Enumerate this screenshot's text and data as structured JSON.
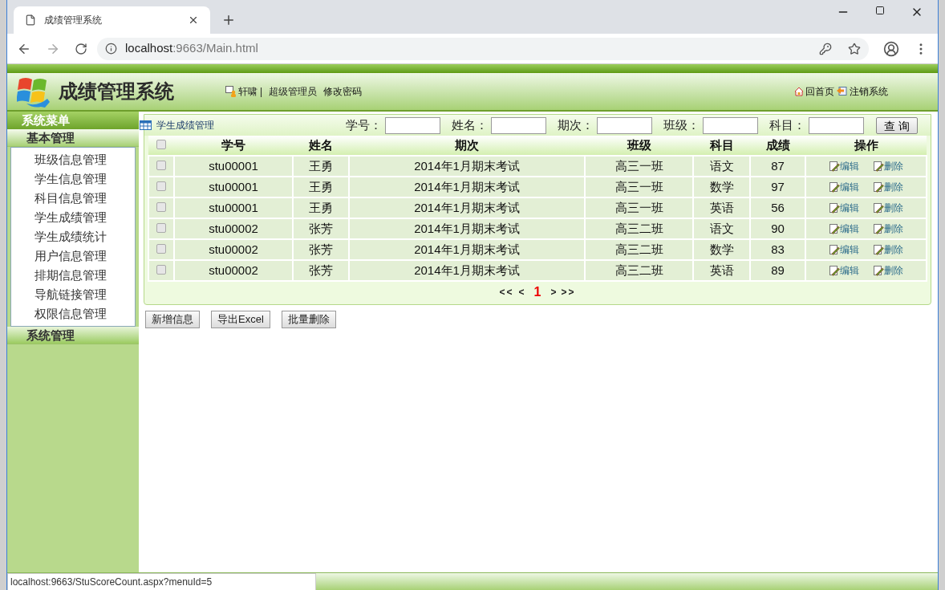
{
  "browser": {
    "tab_title": "成绩管理系统",
    "url_host": "localhost",
    "url_path": ":9663/Main.html"
  },
  "header": {
    "title": "成绩管理系统",
    "user": "轩啸",
    "separator": "|",
    "role": "超级管理员",
    "change_password": "修改密码",
    "home": "回首页",
    "logout": "注销系统"
  },
  "sidebar": {
    "title": "系统菜单",
    "groups": [
      {
        "label": "基本管理",
        "expanded": true,
        "items": [
          "班级信息管理",
          "学生信息管理",
          "科目信息管理",
          "学生成绩管理",
          "学生成绩统计",
          "用户信息管理",
          "排期信息管理",
          "导航链接管理",
          "权限信息管理"
        ]
      },
      {
        "label": "系统管理",
        "expanded": false
      }
    ]
  },
  "panel": {
    "title": "学生成绩管理",
    "filters": [
      "学号：",
      "姓名：",
      "期次：",
      "班级：",
      "科目："
    ],
    "search_button": "查 询"
  },
  "table": {
    "header_checked": false,
    "columns": [
      "学号",
      "姓名",
      "期次",
      "班级",
      "科目",
      "成绩",
      "操作"
    ],
    "rows": [
      {
        "checked": false,
        "cells": [
          "stu00001",
          "王勇",
          "2014年1月期末考试",
          "高三一班",
          "语文",
          "87"
        ],
        "actions": [
          "编辑",
          "删除"
        ]
      },
      {
        "checked": false,
        "cells": [
          "stu00001",
          "王勇",
          "2014年1月期末考试",
          "高三一班",
          "数学",
          "97"
        ],
        "actions": [
          "编辑",
          "删除"
        ]
      },
      {
        "checked": false,
        "cells": [
          "stu00001",
          "王勇",
          "2014年1月期末考试",
          "高三一班",
          "英语",
          "56"
        ],
        "actions": [
          "编辑",
          "删除"
        ]
      },
      {
        "checked": false,
        "cells": [
          "stu00002",
          "张芳",
          "2014年1月期末考试",
          "高三二班",
          "语文",
          "90"
        ],
        "actions": [
          "编辑",
          "删除"
        ]
      },
      {
        "checked": false,
        "cells": [
          "stu00002",
          "张芳",
          "2014年1月期末考试",
          "高三二班",
          "数学",
          "83"
        ],
        "actions": [
          "编辑",
          "删除"
        ]
      },
      {
        "checked": false,
        "cells": [
          "stu00002",
          "张芳",
          "2014年1月期末考试",
          "高三二班",
          "英语",
          "89"
        ],
        "actions": [
          "编辑",
          "删除"
        ]
      }
    ]
  },
  "pagination": {
    "first": "<<",
    "prev": "<",
    "pages": [
      {
        "label": "1",
        "selected": true
      }
    ],
    "next": ">",
    "last": ">>"
  },
  "buttons": [
    "新增信息",
    "导出Excel",
    "批量删除"
  ],
  "status_url": "localhost:9663/StuScoreCount.aspx?menuId=5"
}
